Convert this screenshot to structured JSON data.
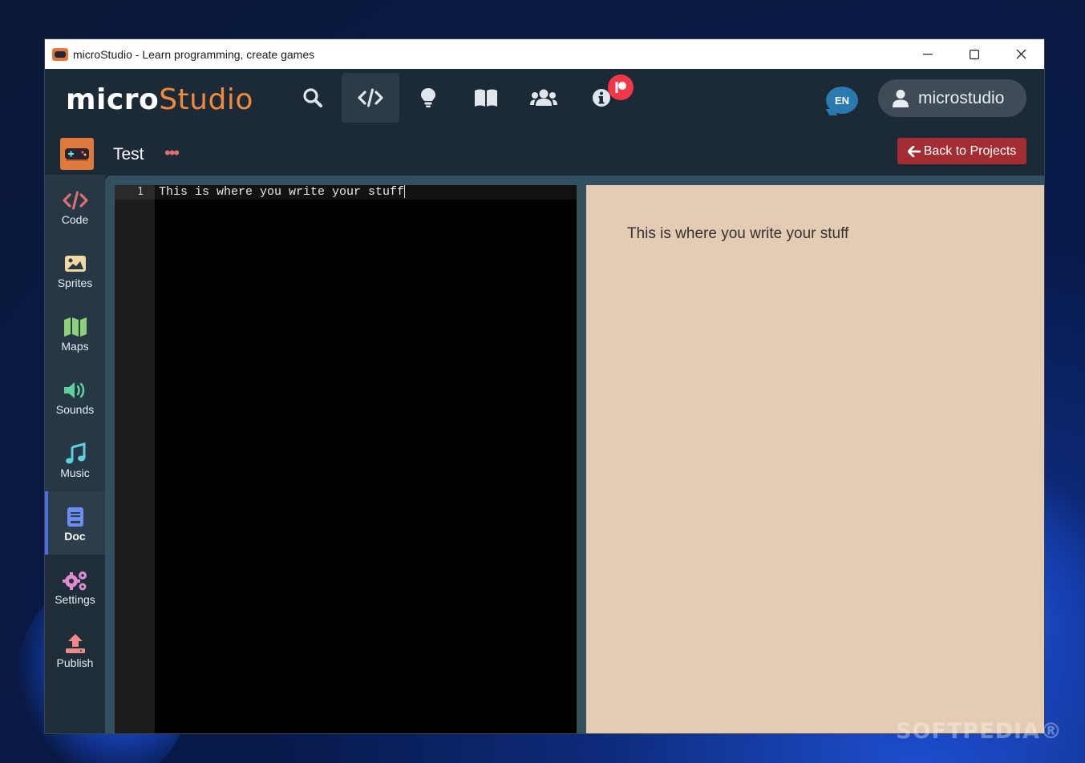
{
  "window": {
    "title": "microStudio - Learn programming, create games",
    "controls": {
      "minimize": "—",
      "maximize": "☐",
      "close": "✕"
    }
  },
  "header": {
    "logo_bold": "micro",
    "logo_light": "Studio",
    "nav_icons": [
      "search-icon",
      "code-icon",
      "lightbulb-icon",
      "book-icon",
      "users-icon",
      "info-icon"
    ],
    "active_nav": "code-icon",
    "language": "EN",
    "username": "microstudio"
  },
  "project": {
    "name": "Test",
    "menu_glyph": "•••",
    "back_button": "Back to Projects"
  },
  "sidebar": {
    "items": [
      {
        "label": "Code",
        "icon": "code-icon",
        "color": "#e07070"
      },
      {
        "label": "Sprites",
        "icon": "image-icon",
        "color": "#f0d8a0"
      },
      {
        "label": "Maps",
        "icon": "map-icon",
        "color": "#8ed07a"
      },
      {
        "label": "Sounds",
        "icon": "speaker-icon",
        "color": "#5fd0a0"
      },
      {
        "label": "Music",
        "icon": "music-icon",
        "color": "#5fd0e0"
      },
      {
        "label": "Doc",
        "icon": "document-icon",
        "color": "#6a8ff0",
        "active": true
      },
      {
        "label": "Settings",
        "icon": "gears-icon",
        "color": "#e08ad0"
      },
      {
        "label": "Publish",
        "icon": "upload-icon",
        "color": "#f08a8a"
      }
    ]
  },
  "editor": {
    "line_number": "1",
    "line_text": "This is where you write your stuff"
  },
  "preview": {
    "text": "This is where you write your stuff"
  },
  "watermark": "SOFTPEDIA®",
  "colors": {
    "accent": "#f08a3a",
    "back_button": "#a32d32",
    "preview_bg": "#e4cbb3",
    "patreon_badge": "#f0384a"
  }
}
